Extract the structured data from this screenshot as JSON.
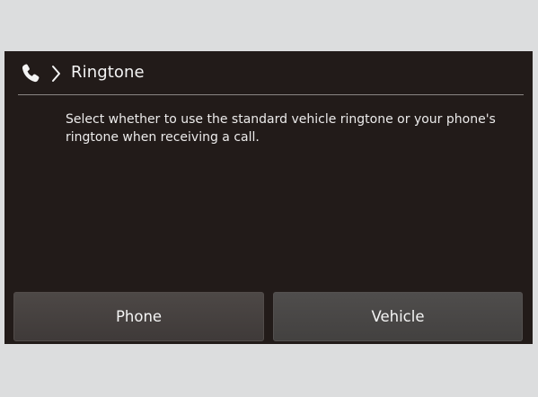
{
  "header": {
    "title": "Ringtone",
    "phone_icon": "phone-handset-icon",
    "chevron_icon": "chevron-right-icon"
  },
  "body": {
    "description": "Select whether to use the standard vehicle ringtone or your phone's ringtone when receiving a call."
  },
  "buttons": {
    "phone_label": "Phone",
    "vehicle_label": "Vehicle"
  },
  "colors": {
    "screen_background": "#221b19",
    "page_background": "#dcddde",
    "text": "#f2f2f2",
    "button_background": "#4a4544"
  }
}
